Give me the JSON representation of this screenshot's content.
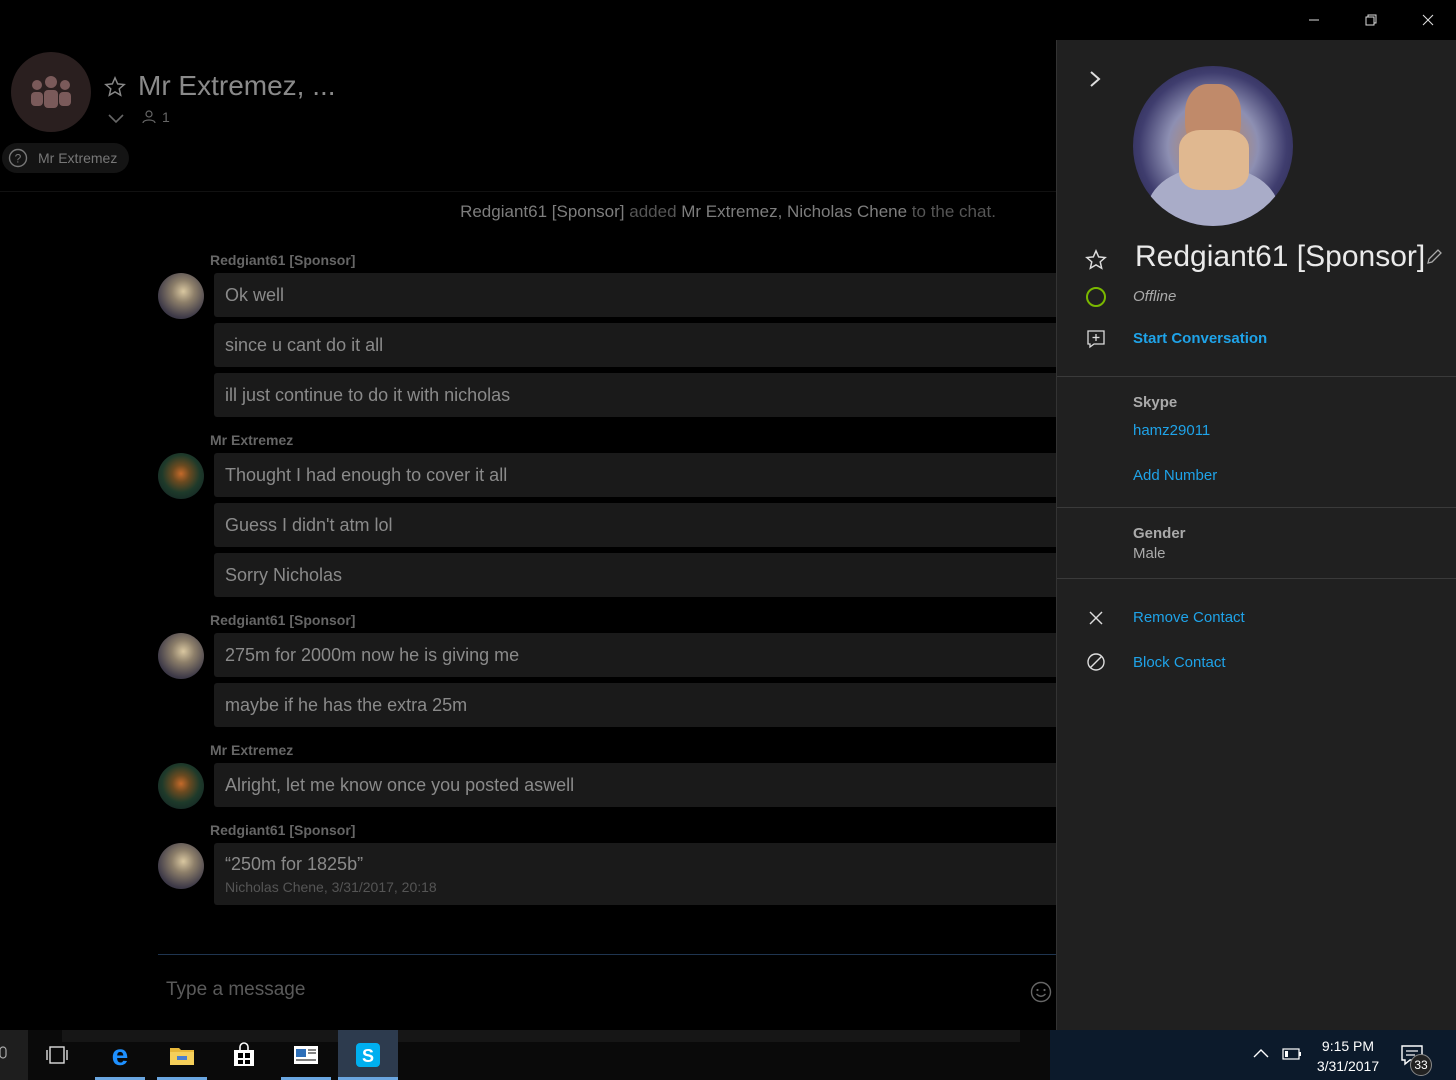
{
  "window": {
    "controls": [
      "minimize",
      "restore",
      "close"
    ]
  },
  "chat": {
    "title": "Mr Extremez, ...",
    "participant_count": "1",
    "member_chip": "Mr Extremez",
    "system_message": {
      "actor": "Redgiant61 [Sponsor]",
      "verb": " added ",
      "targets": "Mr Extremez, Nicholas Chene",
      "suffix": " to the chat."
    },
    "messages": [
      {
        "sender": "Redgiant61 [Sponsor]",
        "lines": [
          "Ok well",
          "since  u cant do it all",
          "ill just continue to do it with nicholas"
        ]
      },
      {
        "sender": "Mr Extremez",
        "lines": [
          "Thought I had enough to cover it all",
          "Guess I didn't atm lol",
          "Sorry Nicholas"
        ]
      },
      {
        "sender": "Redgiant61 [Sponsor]",
        "lines": [
          "275m for 2000m now he is giving me",
          "maybe if he has the extra 25m"
        ]
      },
      {
        "sender": "Mr Extremez",
        "lines": [
          "Alright, let me know once you posted aswell"
        ]
      },
      {
        "sender": "Redgiant61 [Sponsor]",
        "quote": "“250m for 1825b”",
        "quote_meta": "Nicholas Chene, 3/31/2017, 20:18"
      }
    ],
    "composer_placeholder": "Type a message"
  },
  "profile": {
    "name": "Redgiant61 [Sponsor]",
    "status": "Offline",
    "start_conversation": "Start Conversation",
    "skype_label": "Skype",
    "skype_id": "hamz29011",
    "add_number": "Add Number",
    "gender_label": "Gender",
    "gender_value": "Male",
    "remove_contact": "Remove Contact",
    "block_contact": "Block Contact",
    "status_color": "#7ab800",
    "link_color": "#1fa3e8"
  },
  "taskbar": {
    "apps": [
      "task-view-icon",
      "edge-icon",
      "file-explorer-icon",
      "store-icon",
      "news-app-icon",
      "skype-icon"
    ],
    "time": "9:15 PM",
    "date": "3/31/2017",
    "notification_count": "33"
  }
}
